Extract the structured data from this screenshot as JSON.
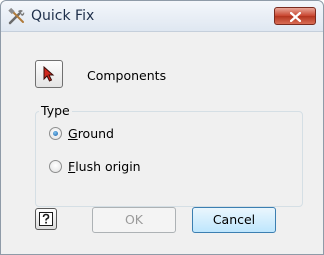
{
  "window": {
    "title": "Quick Fix",
    "app_icon": "tools-icon",
    "close_icon": "close-icon"
  },
  "selection": {
    "pick_icon": "select-cursor-icon",
    "label": "Components"
  },
  "type_group": {
    "title": "Type",
    "options": [
      {
        "label_mnemonic": "G",
        "label_rest": "round",
        "label": "Ground",
        "selected": true
      },
      {
        "label_mnemonic": "F",
        "label_rest": "lush origin",
        "label": "Flush origin",
        "selected": false
      }
    ]
  },
  "buttons": {
    "help_icon": "help-icon",
    "ok_label": "OK",
    "ok_enabled": false,
    "cancel_label": "Cancel"
  },
  "colors": {
    "close_red": "#c8442e",
    "cursor_red": "#d0281e",
    "disabled_text": "#9a9a9a",
    "radio_fill": "#1a5fa8"
  }
}
